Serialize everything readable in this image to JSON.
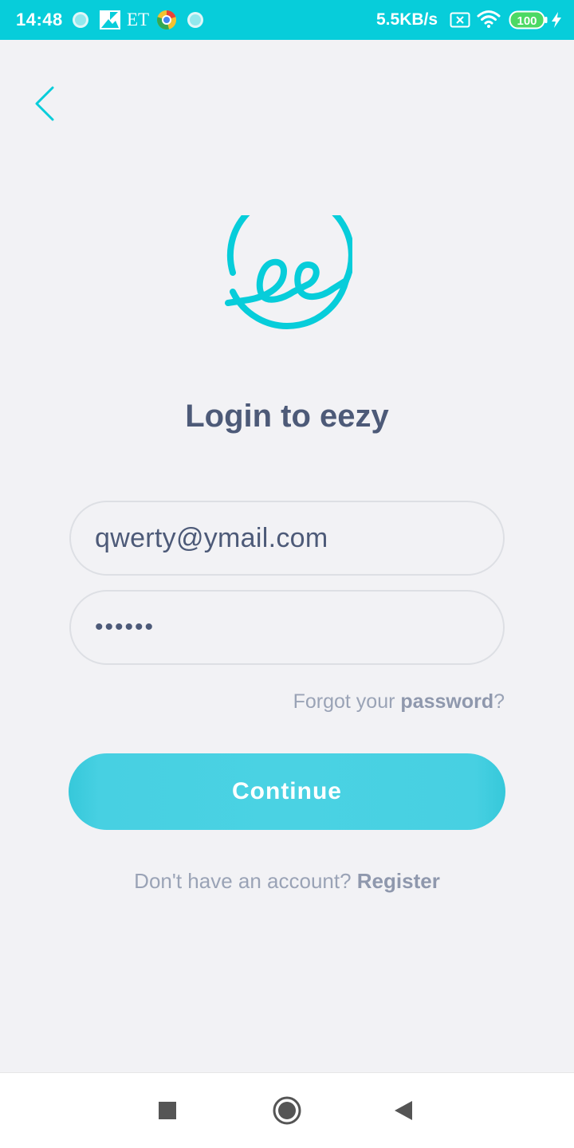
{
  "status_bar": {
    "time": "14:48",
    "app_icons": [
      "circle-icon",
      "photo-icon",
      "et-icon",
      "chrome-icon",
      "circle-icon"
    ],
    "et_label": "ET",
    "network_speed": "5.5KB/s",
    "battery_level": "100",
    "colors": {
      "background": "#07cdda",
      "battery": "#4cd964"
    }
  },
  "header": {
    "back_icon": "chevron-left-icon"
  },
  "logo": {
    "icon": "eezy-logo-icon",
    "color": "#07cdda"
  },
  "page": {
    "title": "Login to eezy"
  },
  "form": {
    "email_value": "qwerty@ymail.com",
    "password_value": "••••••",
    "forgot_prefix": "Forgot your ",
    "forgot_link": "password",
    "forgot_suffix": "?",
    "continue_label": "Continue"
  },
  "footer": {
    "register_prompt": "Don't have an account? ",
    "register_link": "Register"
  },
  "nav_bar": {
    "recents_icon": "square-icon",
    "home_icon": "circle-home-icon",
    "back_icon": "triangle-back-icon"
  },
  "colors": {
    "accent": "#07cdda",
    "button": "#4ad2e3",
    "title_text": "#4d5a78",
    "muted_text": "#9aa3b6",
    "background": "#f2f2f5"
  }
}
